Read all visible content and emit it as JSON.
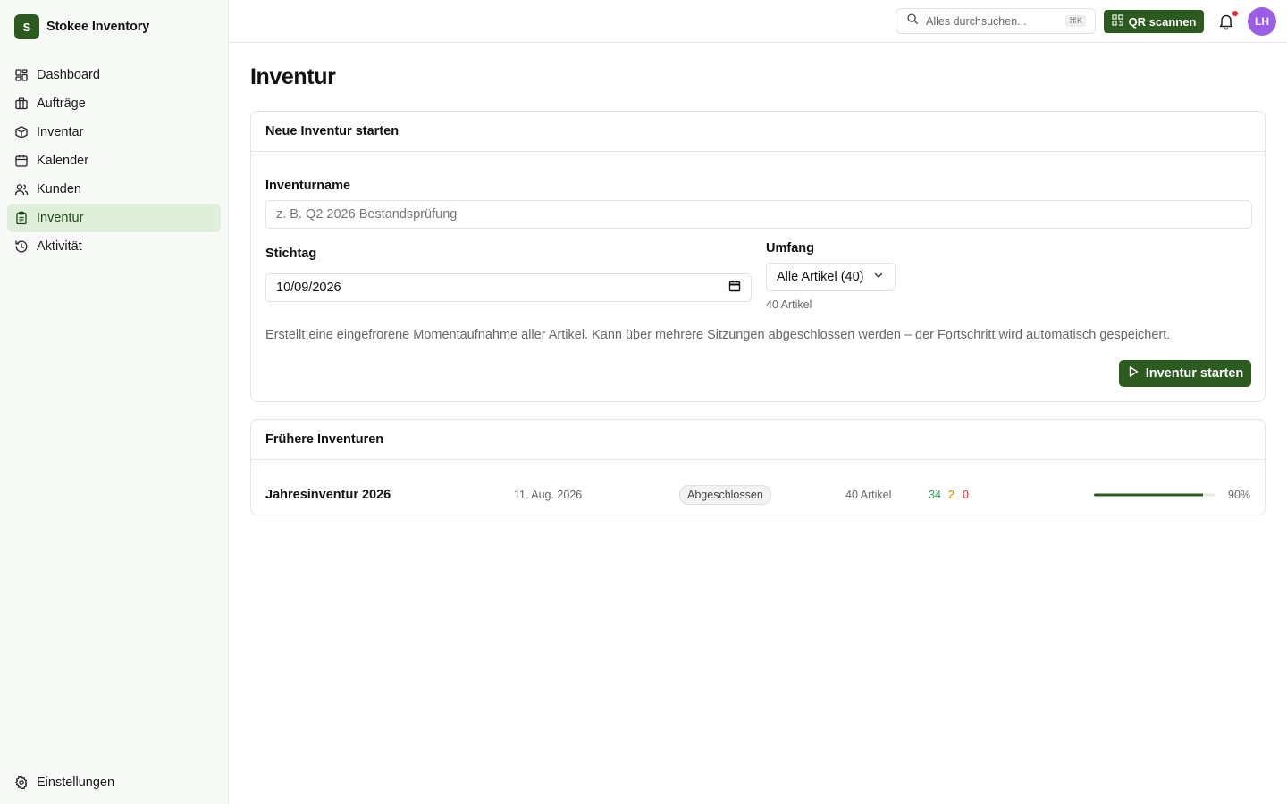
{
  "app": {
    "logo_letter": "S",
    "name": "Stokee Inventory"
  },
  "sidebar": {
    "items": [
      {
        "label": "Dashboard",
        "icon": "dashboard-icon"
      },
      {
        "label": "Aufträge",
        "icon": "briefcase-icon"
      },
      {
        "label": "Inventar",
        "icon": "box-icon"
      },
      {
        "label": "Kalender",
        "icon": "calendar-icon"
      },
      {
        "label": "Kunden",
        "icon": "users-icon"
      },
      {
        "label": "Inventur",
        "icon": "clipboard-icon",
        "active": true
      },
      {
        "label": "Aktivität",
        "icon": "history-icon"
      }
    ],
    "settings_label": "Einstellungen"
  },
  "topbar": {
    "search_placeholder": "Alles durchsuchen...",
    "search_shortcut": "⌘K",
    "qr_label": "QR scannen",
    "avatar_initials": "LH",
    "has_notification": true
  },
  "page": {
    "title": "Inventur"
  },
  "new_inventory": {
    "title": "Neue Inventur starten",
    "name_label": "Inventurname",
    "name_placeholder": "z. B. Q2 2026 Bestandsprüfung",
    "date_label": "Stichtag",
    "date_value": "10/09/2026",
    "scope_label": "Umfang",
    "scope_value": "Alle Artikel (40)",
    "scope_count": "40 Artikel",
    "hint": "Erstellt eine eingefrorene Momentaufnahme aller Artikel. Kann über mehrere Sitzungen abgeschlossen werden – der Fortschritt wird automatisch gespeichert.",
    "start_label": "Inventur starten"
  },
  "history": {
    "title": "Frühere Inventuren",
    "rows": [
      {
        "name": "Jahresinventur 2026",
        "date": "11. Aug. 2026",
        "status": "Abgeschlossen",
        "items": "40 Artikel",
        "ok": "34",
        "warn": "2",
        "err": "0",
        "progress_percent": 90,
        "progress_label": "90%"
      }
    ]
  },
  "colors": {
    "brand": "#2d5a1f",
    "active_bg": "#e0eedc",
    "ok": "#2f9e55",
    "warn": "#c6870c",
    "err": "#d42b2b",
    "avatar": "#9b5de5"
  }
}
